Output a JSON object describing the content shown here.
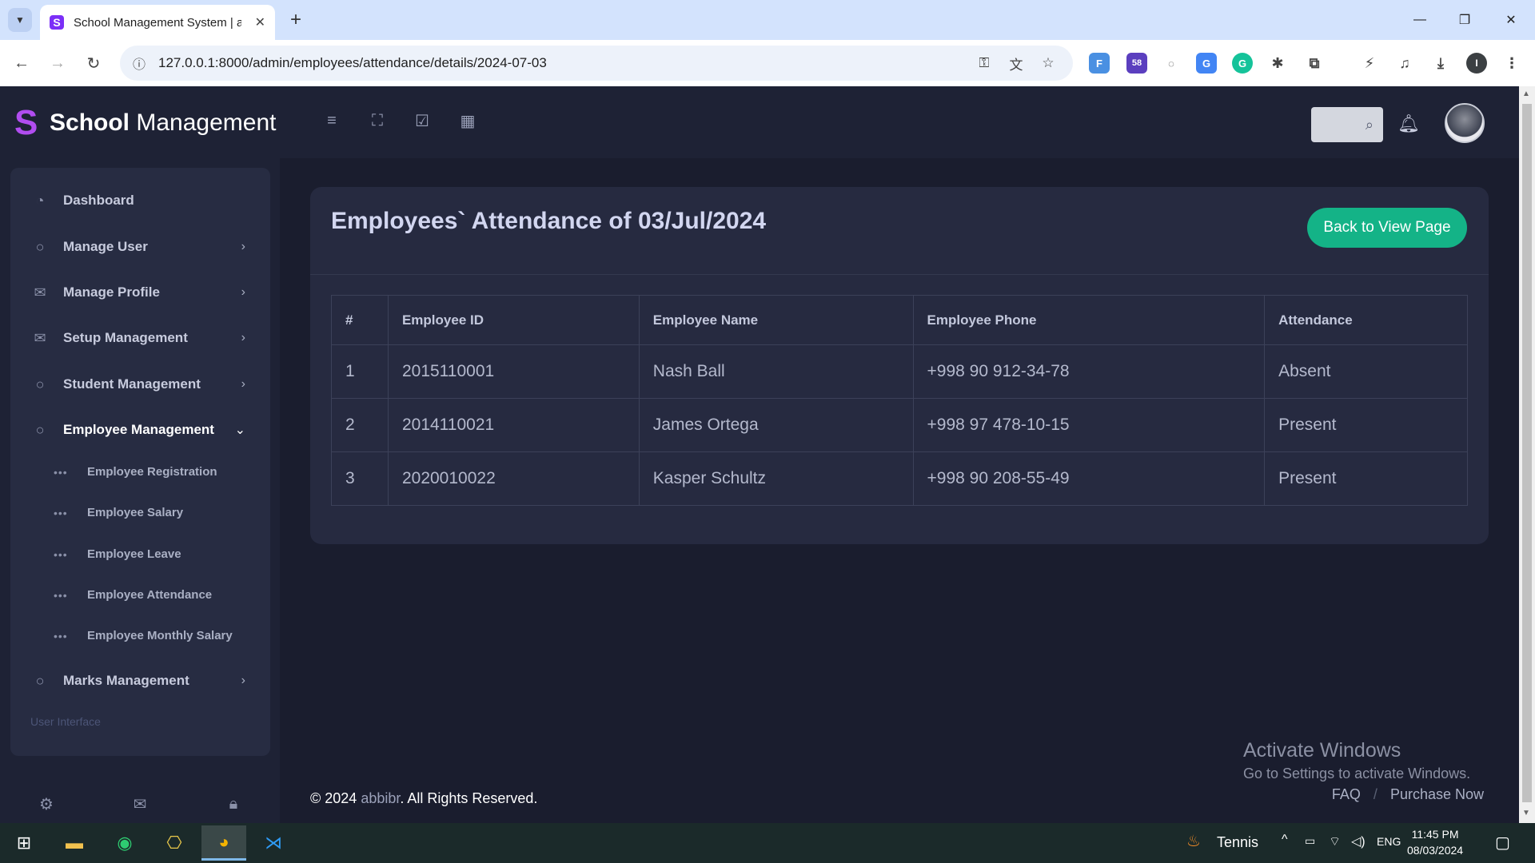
{
  "browser": {
    "tab_title": "School Management System | a",
    "url": "127.0.0.1:8000/admin/employees/attendance/details/2024-07-03",
    "extension_badge": "58"
  },
  "brand": {
    "bold": "School",
    "light": " Management"
  },
  "sidebar": {
    "items": [
      {
        "label": "Dashboard",
        "icon": "pie-chart-icon"
      },
      {
        "label": "Manage User",
        "icon": "chat-bubble-icon"
      },
      {
        "label": "Manage Profile",
        "icon": "mail-icon"
      },
      {
        "label": "Setup Management",
        "icon": "mail-icon"
      },
      {
        "label": "Student Management",
        "icon": "chat-bubble-icon"
      },
      {
        "label": "Employee Management",
        "icon": "chat-bubble-icon"
      },
      {
        "label": "Marks Management",
        "icon": "chat-bubble-icon"
      }
    ],
    "subitems": [
      "Employee Registration",
      "Employee Salary",
      "Employee Leave",
      "Employee Attendance",
      "Employee Monthly Salary"
    ],
    "section_label": "User Interface"
  },
  "page": {
    "title": "Employees` Attendance of 03/Jul/2024",
    "back_button": "Back to View Page",
    "table": {
      "headers": [
        "#",
        "Employee ID",
        "Employee Name",
        "Employee Phone",
        "Attendance"
      ],
      "rows": [
        [
          "1",
          "2015110001",
          "Nash Ball",
          "+998 90 912-34-78",
          "Absent"
        ],
        [
          "2",
          "2014110021",
          "James Ortega",
          "+998 97 478-10-15",
          "Present"
        ],
        [
          "3",
          "2020010022",
          "Kasper Schultz",
          "+998 90 208-55-49",
          "Present"
        ]
      ]
    }
  },
  "footer": {
    "copyright_prefix": "© 2024 ",
    "brand": "abbibr",
    "copyright_suffix": ". All Rights Reserved.",
    "links": [
      "FAQ",
      "Purchase Now"
    ]
  },
  "watermark": {
    "line1": "Activate Windows",
    "line2": "Go to Settings to activate Windows."
  },
  "taskbar": {
    "weather": "Tennis",
    "language": "ENG",
    "time": "11:45 PM",
    "date": "08/03/2024"
  },
  "colors": {
    "accent": "#14b387",
    "absent": "#ffe000",
    "present": "#22c55e",
    "brand_logo": "#b14df0"
  }
}
